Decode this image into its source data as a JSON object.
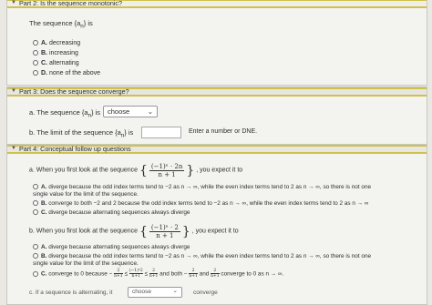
{
  "part2": {
    "header": "Part 2: Is the sequence monotonic?",
    "question": "The sequence {a",
    "question_sub": "n",
    "question_end": "} is",
    "options": [
      {
        "letter": "A.",
        "text": "decreasing"
      },
      {
        "letter": "B.",
        "text": "increasing"
      },
      {
        "letter": "C.",
        "text": "alternating"
      },
      {
        "letter": "D.",
        "text": "none of the above"
      }
    ]
  },
  "part3": {
    "header": "Part 3: Does the sequence converge?",
    "a_prefix": "a. The sequence {a",
    "a_sub": "n",
    "a_suffix": "} is",
    "a_select": "choose",
    "b_prefix": "b. The limit of the sequence {a",
    "b_sub": "n",
    "b_suffix": "} is",
    "b_hint": "Enter a number or DNE."
  },
  "part4": {
    "header": "Part 4: Conceptual follow up questions",
    "a_prefix": "a. When you first look at the sequence",
    "a_num": "(−1)ⁿ · 2n",
    "a_den": "n + 1",
    "a_suffix": ", you expect it to",
    "a_options": [
      {
        "letter": "A.",
        "text1": "diverge because the odd index terms tend to −2 as n → ∞, while the even index terms tend to 2 as n → ∞, so there is not one",
        "text2": "single value for the limit of the sequence."
      },
      {
        "letter": "B.",
        "text1": "converge to both −2 and 2 because the odd index terms tend to −2 as n → ∞, while the even index terms tend to 2 as n → ∞",
        "text2": ""
      },
      {
        "letter": "C.",
        "text1": "diverge because alternating sequences always diverge",
        "text2": ""
      }
    ],
    "b_prefix": "b. When you first look at the sequence",
    "b_num": "(−1)ⁿ · 2",
    "b_den": "n + 1",
    "b_suffix": ", you expect it to",
    "b_options": [
      {
        "letter": "A.",
        "text1": "diverge because alternating sequences always diverge",
        "text2": ""
      },
      {
        "letter": "B.",
        "text1": "diverge because the odd index terms tend to −2 as n → ∞, while the even index terms tend to 2 as n → ∞, so there is not one",
        "text2": "single value for the limit of the sequence."
      }
    ],
    "b_c_letter": "C.",
    "b_c_text1": "converge to 0 because −",
    "b_c_f1n": "2",
    "b_c_f1d": "n+1",
    "b_c_f2n": "(−1)ⁿ2",
    "b_c_f2d": "n+1",
    "b_c_f3n": "2",
    "b_c_f3d": "n+1",
    "b_c_mid": "and both −",
    "b_c_f4n": "2",
    "b_c_f4d": "n+1",
    "b_c_and": "and",
    "b_c_f5n": "2",
    "b_c_f5d": "n+1",
    "b_c_end": "converge to 0 as n → ∞.",
    "c_prefix": "c. If a sequence is alternating, it",
    "c_select": "choose",
    "c_suffix": "converge"
  }
}
